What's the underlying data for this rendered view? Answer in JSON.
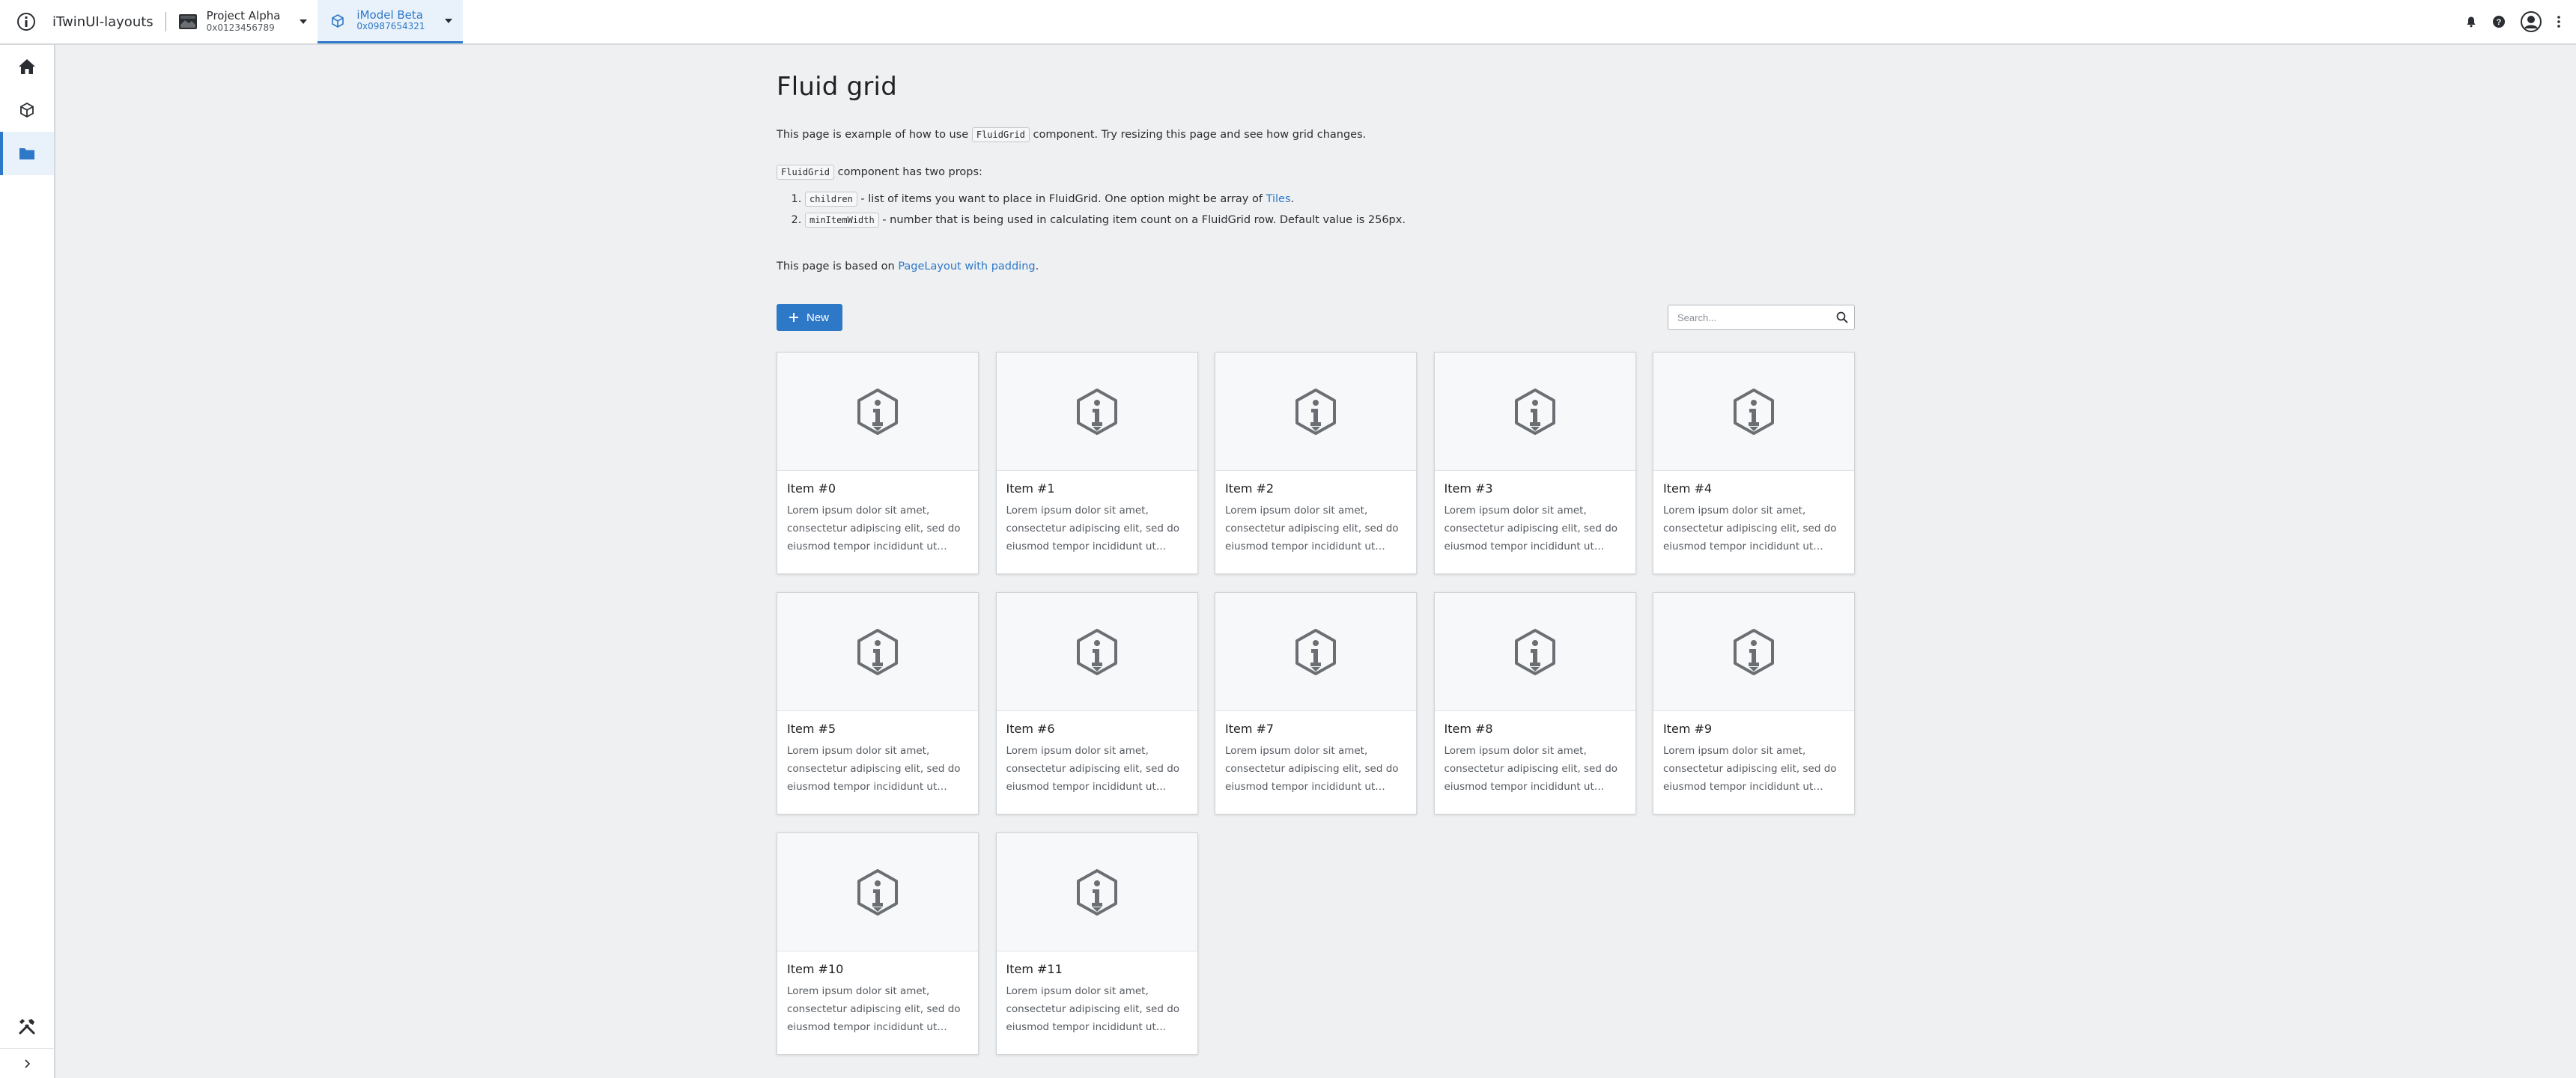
{
  "header": {
    "app_title": "iTwinUI-layouts",
    "project": {
      "name": "Project Alpha",
      "id": "0x0123456789"
    },
    "imodel": {
      "name": "iModel Beta",
      "id": "0x0987654321"
    }
  },
  "siderail": {
    "items": [
      {
        "icon": "home-icon"
      },
      {
        "icon": "cube-icon"
      },
      {
        "icon": "folder-icon",
        "active": true
      }
    ],
    "bottom": [
      {
        "icon": "tools-icon"
      },
      {
        "icon": "chevron-right-icon"
      }
    ]
  },
  "page": {
    "title": "Fluid grid",
    "intro_before": "This page is example of how to use",
    "intro_code": "FluidGrid",
    "intro_after": "component. Try resizing this page and see how grid changes.",
    "props_code": "FluidGrid",
    "props_text": "component has two props:",
    "props": [
      {
        "code": "children",
        "text": " - list of items you want to place in FluidGrid. One option might be array of ",
        "link": "Tiles",
        "end": "."
      },
      {
        "code": "minItemWidth",
        "text": " - number that is being used in calculating item count on a FluidGrid row. Default value is 256px.",
        "link": "",
        "end": ""
      }
    ],
    "based_on_text": "This page is based on",
    "based_on_link": "PageLayout with padding",
    "based_on_end": "."
  },
  "toolbar": {
    "new_label": "New",
    "search_placeholder": "Search..."
  },
  "tiles": [
    {
      "name": "Item #0",
      "description": "Lorem ipsum dolor sit amet, consectetur adipiscing elit, sed do eiusmod tempor incididunt ut labo..."
    },
    {
      "name": "Item #1",
      "description": "Lorem ipsum dolor sit amet, consectetur adipiscing elit, sed do eiusmod tempor incididunt ut labo..."
    },
    {
      "name": "Item #2",
      "description": "Lorem ipsum dolor sit amet, consectetur adipiscing elit, sed do eiusmod tempor incididunt ut labo..."
    },
    {
      "name": "Item #3",
      "description": "Lorem ipsum dolor sit amet, consectetur adipiscing elit, sed do eiusmod tempor incididunt ut labo..."
    },
    {
      "name": "Item #4",
      "description": "Lorem ipsum dolor sit amet, consectetur adipiscing elit, sed do eiusmod tempor incididunt ut labo..."
    },
    {
      "name": "Item #5",
      "description": "Lorem ipsum dolor sit amet, consectetur adipiscing elit, sed do eiusmod tempor incididunt ut labo..."
    },
    {
      "name": "Item #6",
      "description": "Lorem ipsum dolor sit amet, consectetur adipiscing elit, sed do eiusmod tempor incididunt ut labo..."
    },
    {
      "name": "Item #7",
      "description": "Lorem ipsum dolor sit amet, consectetur adipiscing elit, sed do eiusmod tempor incididunt ut labo..."
    },
    {
      "name": "Item #8",
      "description": "Lorem ipsum dolor sit amet, consectetur adipiscing elit, sed do eiusmod tempor incididunt ut labo..."
    },
    {
      "name": "Item #9",
      "description": "Lorem ipsum dolor sit amet, consectetur adipiscing elit, sed do eiusmod tempor incididunt ut labo..."
    },
    {
      "name": "Item #10",
      "description": "Lorem ipsum dolor sit amet, consectetur adipiscing elit, sed do eiusmod tempor incididunt ut labo..."
    },
    {
      "name": "Item #11",
      "description": "Lorem ipsum dolor sit amet, consectetur adipiscing elit, sed do eiusmod tempor incididunt ut labo..."
    }
  ],
  "colors": {
    "accent": "#2e78c8",
    "background": "#eef0f1",
    "icon_gray": "#6b6f74"
  }
}
